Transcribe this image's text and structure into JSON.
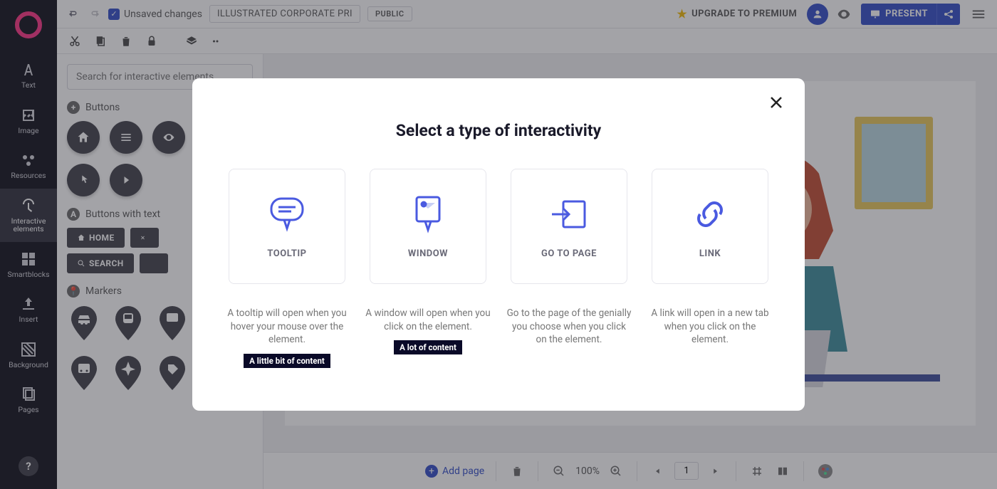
{
  "sidebar": {
    "items": [
      {
        "label": "Text"
      },
      {
        "label": "Image"
      },
      {
        "label": "Resources"
      },
      {
        "label": "Interactive elements"
      },
      {
        "label": "Smartblocks"
      },
      {
        "label": "Insert"
      },
      {
        "label": "Background"
      },
      {
        "label": "Pages"
      }
    ],
    "help": "?"
  },
  "topbar": {
    "unsaved": "Unsaved changes",
    "doc_title": "ILLUSTRATED CORPORATE PRI",
    "badge": "PUBLIC",
    "upgrade": "UPGRADE TO PREMIUM",
    "present": "PRESENT"
  },
  "panel": {
    "search_placeholder": "Search for interactive elements",
    "sections": {
      "buttons": "Buttons",
      "buttons_text": "Buttons with text",
      "markers": "Markers"
    },
    "text_buttons": {
      "home": "HOME",
      "search": "SEARCH"
    }
  },
  "bottombar": {
    "add_page": "Add page",
    "zoom": "100%",
    "page": "1"
  },
  "modal": {
    "title": "Select a type of interactivity",
    "options": [
      {
        "label": "TOOLTIP",
        "desc": "A tooltip will open when you hover your mouse over the element.",
        "tag": "A little bit of content"
      },
      {
        "label": "WINDOW",
        "desc": "A window will open when you click on the element.",
        "tag": "A lot of content"
      },
      {
        "label": "GO TO PAGE",
        "desc": "Go to the page of the genially you choose when you click on the element."
      },
      {
        "label": "LINK",
        "desc": "A link will open in a new tab when you click on the element."
      }
    ]
  }
}
